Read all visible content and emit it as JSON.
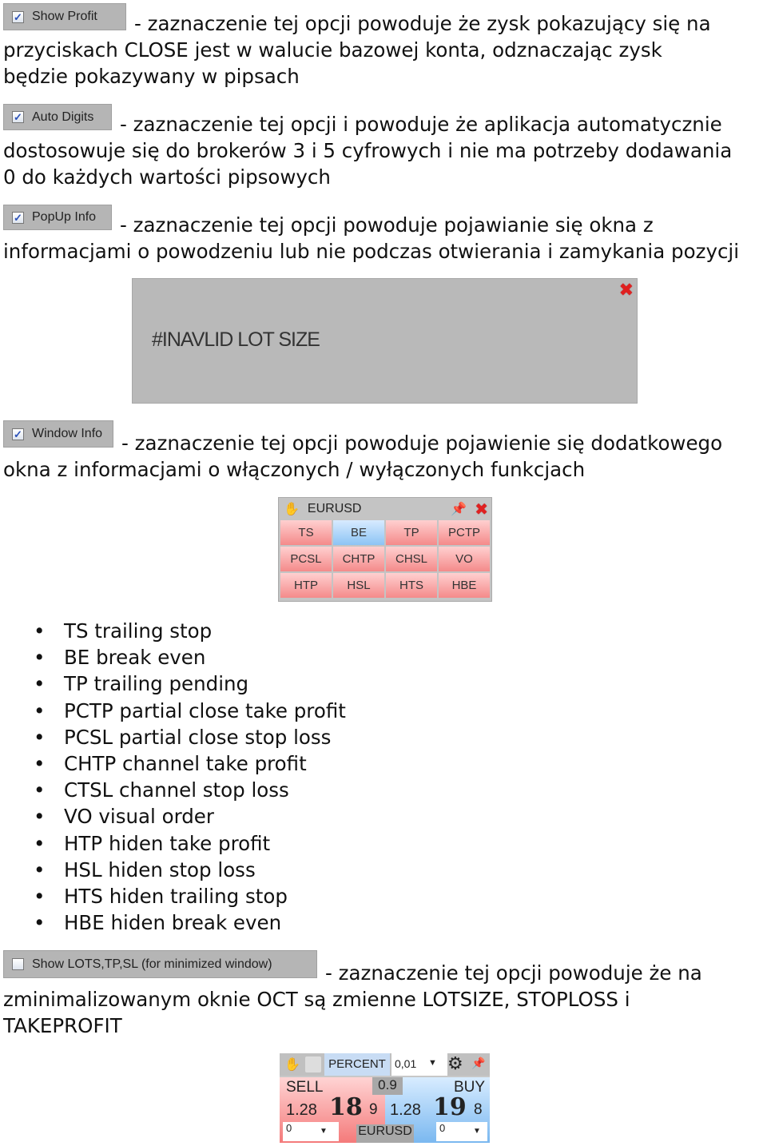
{
  "options": [
    {
      "label": "Show Profit",
      "checked": true,
      "lines": [
        "- zaznaczenie tej opcji powoduje że zysk pokazujący się na",
        "przyciskach CLOSE jest w walucie bazowej  konta, odznaczając zysk",
        "będzie pokazywany w pipsach"
      ]
    },
    {
      "label": "Auto Digits",
      "checked": true,
      "lines": [
        "- zaznaczenie tej opcji i powoduje że aplikacja automatycznie",
        "dostosowuje się do brokerów 3 i 5 cyfrowych i nie ma potrzeby dodawania",
        "0 do każdych wartości pipsowych"
      ]
    },
    {
      "label": "PopUp Info",
      "checked": true,
      "lines": [
        "- zaznaczenie tej opcji powoduje pojawianie się okna z",
        "informacjami o powodzeniu lub nie podczas otwierania i zamykania pozycji"
      ]
    },
    {
      "label": "Window Info",
      "checked": true,
      "lines": [
        "- zaznaczenie tej opcji powoduje pojawienie się dodatkowego",
        "okna z informacjami o włączonych / wyłączonych funkcjach"
      ]
    },
    {
      "label": "Show LOTS,TP,SL (for minimized window)",
      "checked": false,
      "lines": [
        "- zaznaczenie tej opcji powoduje że na",
        "zminimalizowanym oknie OCT są zmienne LOTSIZE, STOPLOSS i",
        "TAKEPROFIT"
      ]
    }
  ],
  "popup": {
    "message": "#INAVLID LOT SIZE"
  },
  "info_window": {
    "symbol": "EURUSD",
    "buttons": [
      {
        "label": "TS",
        "active": false
      },
      {
        "label": "BE",
        "active": true
      },
      {
        "label": "TP",
        "active": false
      },
      {
        "label": "PCTP",
        "active": false
      },
      {
        "label": "PCSL",
        "active": false
      },
      {
        "label": "CHTP",
        "active": false
      },
      {
        "label": "CHSL",
        "active": false
      },
      {
        "label": "VO",
        "active": false
      },
      {
        "label": "HTP",
        "active": false
      },
      {
        "label": "HSL",
        "active": false
      },
      {
        "label": "HTS",
        "active": false
      },
      {
        "label": "HBE",
        "active": false
      }
    ]
  },
  "legend": [
    "TS trailing stop",
    "BE break even",
    "TP trailing pending",
    "PCTP partial close take profit",
    "PCSL partial close stop loss",
    "CHTP channel take profit",
    "CTSL channel stop loss",
    "VO visual order",
    "HTP hiden take profit",
    "HSL hiden stop loss",
    "HTS hiden trailing stop",
    "HBE hiden break even"
  ],
  "mini_window": {
    "mode": "PERCENT",
    "lot": "0,01",
    "sell": "SELL",
    "buy": "BUY",
    "spread": "0.9",
    "sell_big": "1.28",
    "sell_pips": "18",
    "sell_small": "9",
    "buy_big": "1.28",
    "buy_pips": "19",
    "buy_small": "8",
    "sl": "0",
    "tp": "0",
    "symbol": "EURUSD"
  },
  "colors": {
    "sell": "#f48a8a",
    "buy": "#8cc4f4",
    "close": "#e02020"
  }
}
